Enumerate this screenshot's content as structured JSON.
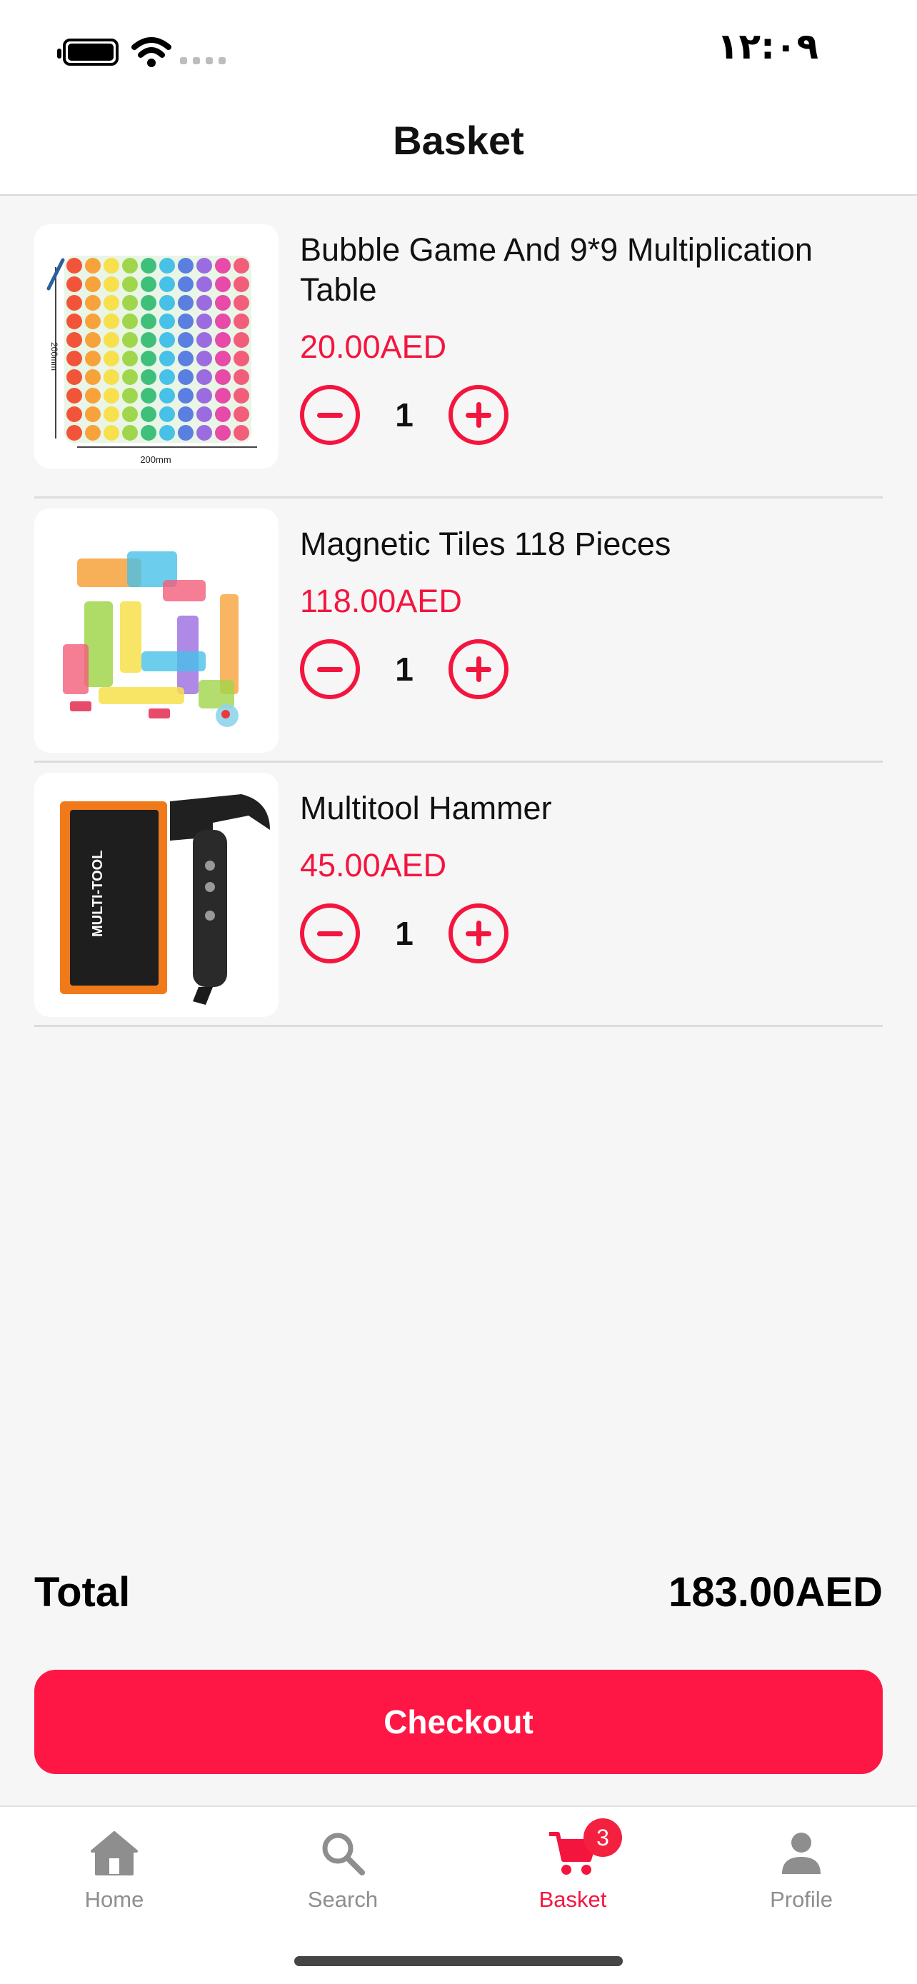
{
  "status_bar": {
    "time": "١٢:٠٩"
  },
  "header": {
    "title": "Basket"
  },
  "items": [
    {
      "name": "Bubble Game And 9*9 Multiplication Table",
      "price": "20.00AED",
      "quantity": "1",
      "image_caption": "200mm",
      "image_side_caption": "200mm"
    },
    {
      "name": "Magnetic Tiles 118 Pieces",
      "price": "118.00AED",
      "quantity": "1"
    },
    {
      "name": "Multitool Hammer",
      "price": "45.00AED",
      "quantity": "1",
      "image_box_text": "MULTI-TOOL"
    }
  ],
  "summary": {
    "total_label": "Total",
    "total_value": "183.00AED"
  },
  "checkout": {
    "label": "Checkout"
  },
  "nav": {
    "tabs": [
      {
        "label": "Home",
        "icon": "home-icon"
      },
      {
        "label": "Search",
        "icon": "search-icon"
      },
      {
        "label": "Basket",
        "icon": "cart-icon",
        "badge": "3"
      },
      {
        "label": "Profile",
        "icon": "person-icon"
      }
    ]
  },
  "colors": {
    "accent": "#f4153f",
    "checkout": "#fe1744",
    "inactive": "#8e8e8e"
  }
}
